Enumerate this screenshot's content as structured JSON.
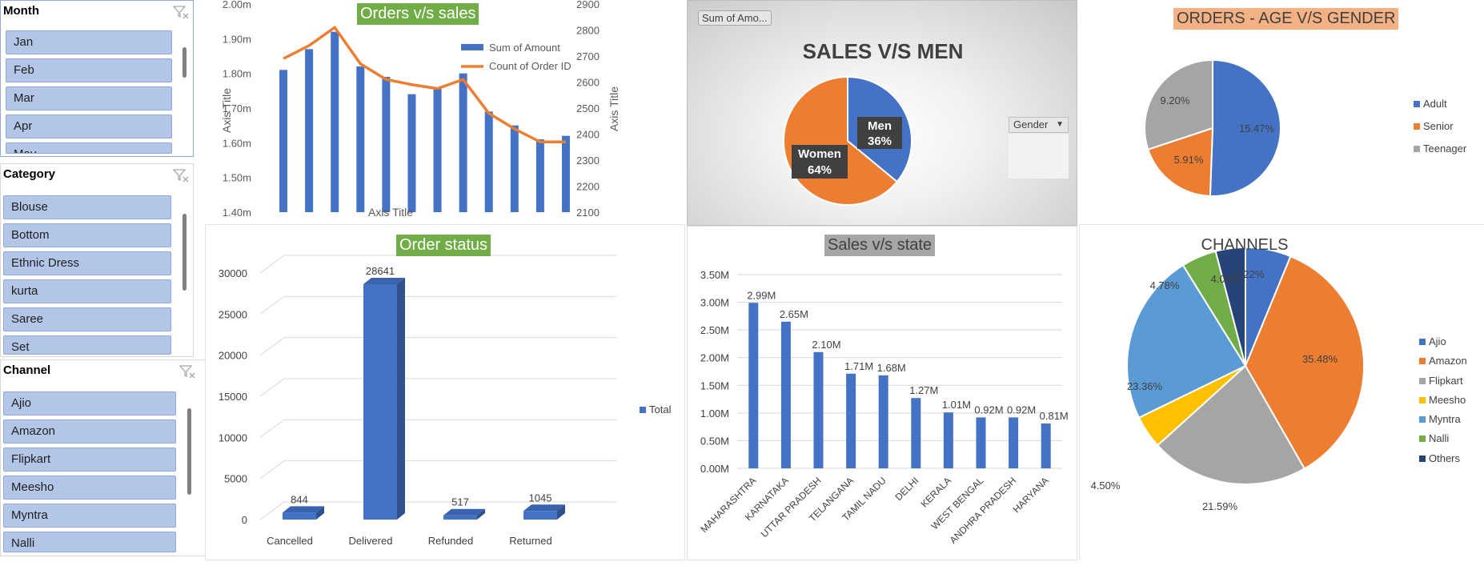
{
  "slicers": {
    "month": {
      "title": "Month",
      "items": [
        "Jan",
        "Feb",
        "Mar",
        "Apr",
        "May"
      ]
    },
    "category": {
      "title": "Category",
      "items": [
        "Blouse",
        "Bottom",
        "Ethnic Dress",
        "kurta",
        "Saree",
        "Set"
      ]
    },
    "channel": {
      "title": "Channel",
      "items": [
        "Ajio",
        "Amazon",
        "Flipkart",
        "Meesho",
        "Myntra",
        "Nalli"
      ]
    }
  },
  "colors": {
    "blue": "#4472c4",
    "orange": "#ed7d31",
    "gray": "#a5a5a5",
    "yellow": "#ffc000",
    "lightblue": "#5b9bd5",
    "green": "#70ad47",
    "navy": "#264478",
    "title_green": "#70ad47",
    "title_salmon": "#f4b183",
    "title_gray": "#a6a6a6"
  },
  "icons": {
    "filter": "clear-filter-icon"
  },
  "chart_data": [
    {
      "type": "bar",
      "title": "Orders v/s sales",
      "xlabel": "Axis Title",
      "ylabel": "Axis Title",
      "y2label": "Axis Title",
      "ylim": [
        1.4,
        2.0
      ],
      "y2lim": [
        2100,
        2900
      ],
      "yticks": [
        "1.40m",
        "1.50m",
        "1.60m",
        "1.70m",
        "1.80m",
        "1.90m",
        "2.00m"
      ],
      "y2ticks": [
        "2100",
        "2200",
        "2300",
        "2400",
        "2500",
        "2600",
        "2700",
        "2800",
        "2900"
      ],
      "legend": [
        "Sum of Amount",
        "Count of Order ID"
      ],
      "series": [
        {
          "name": "Sum of Amount",
          "kind": "bar",
          "values": [
            1.81,
            1.87,
            1.92,
            1.82,
            1.79,
            1.74,
            1.76,
            1.8,
            1.69,
            1.65,
            1.61,
            1.62
          ]
        },
        {
          "name": "Count of Order ID",
          "kind": "line",
          "values": [
            2690,
            2740,
            2810,
            2670,
            2610,
            2590,
            2575,
            2610,
            2480,
            2420,
            2370,
            2370
          ]
        }
      ]
    },
    {
      "type": "pie",
      "title": "SALES V/S MEN",
      "field_button": "Sum of Amo...",
      "legend_title": "Gender",
      "legend": [
        "Men",
        "Women"
      ],
      "labels": [
        [
          "Men",
          "36%"
        ],
        [
          "Women",
          "64%"
        ]
      ],
      "values": [
        36,
        64
      ]
    },
    {
      "type": "pie",
      "title": "ORDERS - AGE V/S GENDER",
      "legend": [
        "Adult",
        "Senior",
        "Teenager"
      ],
      "values": [
        15.47,
        5.91,
        9.2
      ],
      "labels": [
        "15.47%",
        "5.91%",
        "9.20%"
      ]
    },
    {
      "type": "bar",
      "title": "Order status",
      "categories": [
        "Cancelled",
        "Delivered",
        "Refunded",
        "Returned"
      ],
      "values": [
        844,
        28641,
        517,
        1045
      ],
      "data_labels": [
        "844",
        "28641",
        "517",
        "1045"
      ],
      "ylim": [
        0,
        30000
      ],
      "yticks": [
        "0",
        "5000",
        "10000",
        "15000",
        "20000",
        "25000",
        "30000"
      ],
      "legend": [
        "Total"
      ]
    },
    {
      "type": "bar",
      "title": "Sales v/s state",
      "categories": [
        "MAHARASHTRA",
        "KARNATAKA",
        "UTTAR PRADESH",
        "TELANGANA",
        "TAMIL NADU",
        "DELHI",
        "KERALA",
        "WEST BENGAL",
        "ANDHRA PRADESH",
        "HARYANA"
      ],
      "values": [
        2.99,
        2.65,
        2.1,
        1.71,
        1.68,
        1.27,
        1.01,
        0.92,
        0.92,
        0.81
      ],
      "data_labels": [
        "2.99M",
        "2.65M",
        "2.10M",
        "1.71M",
        "1.68M",
        "1.27M",
        "1.01M",
        "0.92M",
        "0.92M",
        "0.81M"
      ],
      "ylim": [
        0,
        3.5
      ],
      "yticks": [
        "0.00M",
        "0.50M",
        "1.00M",
        "1.50M",
        "2.00M",
        "2.50M",
        "3.00M",
        "3.50M"
      ]
    },
    {
      "type": "pie",
      "title": "CHANNELS",
      "legend": [
        "Ajio",
        "Amazon",
        "Flipkart",
        "Meesho",
        "Myntra",
        "Nalli",
        "Others"
      ],
      "values": [
        6.22,
        35.48,
        21.59,
        4.5,
        23.36,
        4.78,
        4.06
      ],
      "labels": [
        "6.22%",
        "35.48%",
        "21.59%",
        "4.50%",
        "23.36%",
        "4.78%",
        "4.06%"
      ]
    }
  ]
}
